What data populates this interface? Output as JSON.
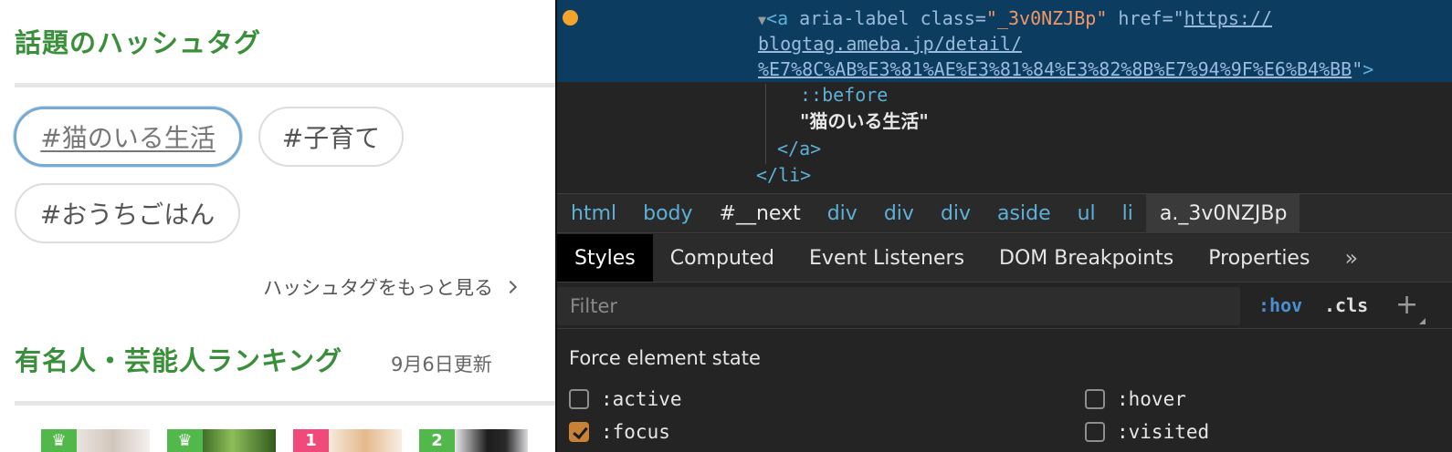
{
  "page": {
    "hashtag_section": {
      "title": "話題のハッシュタグ",
      "tags": [
        "#猫のいる生活",
        "#子育て",
        "#おうちごはん"
      ],
      "more_link": "ハッシュタグをもっと見る"
    },
    "ranking_section": {
      "title": "有名人・芸能人ランキング",
      "updated": "9月6日更新",
      "badges": [
        "♛",
        "♛",
        "1",
        "2"
      ],
      "badge_colors": [
        "#52b84c",
        "#52b84c",
        "#f04a7a",
        "#52b84c"
      ]
    }
  },
  "devtools": {
    "dom": {
      "open_tag": "<a",
      "attr_aria": "aria-label",
      "attr_class": "class",
      "class_value": "\"_3v0NZJBp\"",
      "attr_href": "href",
      "href_line1": "https://",
      "href_line2": "blogtag.ameba.jp/detail/",
      "href_line3": "%E7%8C%AB%E3%81%AE%E3%81%84%E3%82%8B%E7%94%9F%E6%B4%BB",
      "tag_close": ">",
      "pseudo_before": "::before",
      "text_node": "\"猫のいる生活\"",
      "close_a": "</a>",
      "close_li": "</li>"
    },
    "breadcrumbs": [
      "html",
      "body",
      "#__next",
      "div",
      "div",
      "div",
      "aside",
      "ul",
      "li",
      "a._3v0NZJBp"
    ],
    "tabs": [
      "Styles",
      "Computed",
      "Event Listeners",
      "DOM Breakpoints",
      "Properties",
      "»"
    ],
    "filter_placeholder": "Filter",
    "hov_label": ":hov",
    "cls_label": ".cls",
    "add_label": "+",
    "force_state_title": "Force element state",
    "states": {
      "active": {
        "label": ":active",
        "checked": false
      },
      "hover": {
        "label": ":hover",
        "checked": false
      },
      "focus": {
        "label": ":focus",
        "checked": true
      },
      "visited": {
        "label": ":visited",
        "checked": false
      }
    },
    "colors": {
      "selection_bg": "#0d3c61",
      "panel_bg": "#242424",
      "tag_color": "#5db0d7",
      "value_color": "#f29766",
      "checkbox_checked": "#c98235"
    }
  }
}
